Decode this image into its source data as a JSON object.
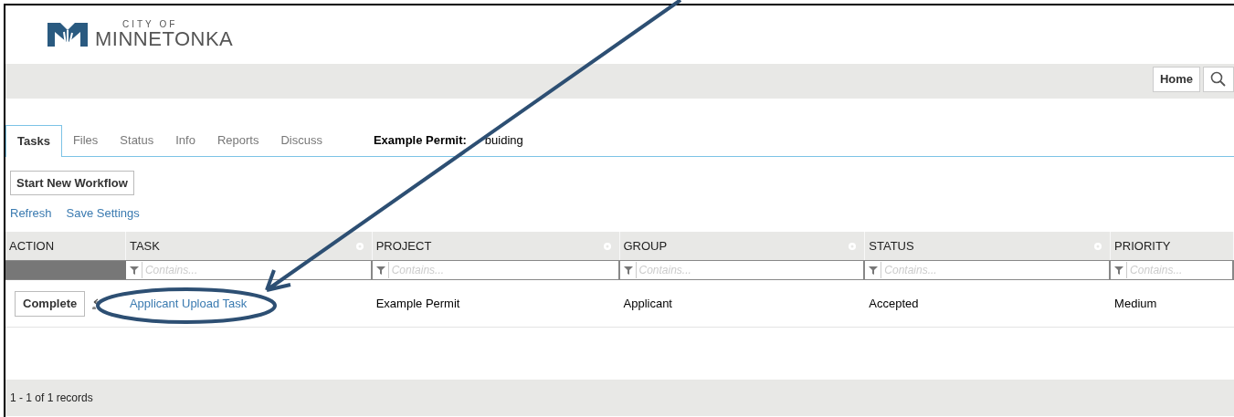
{
  "logo": {
    "small": "CITY OF",
    "big": "MINNETONKA"
  },
  "toolbar": {
    "home": "Home"
  },
  "tabs": [
    {
      "label": "Tasks",
      "selected": true
    },
    {
      "label": "Files",
      "selected": false
    },
    {
      "label": "Status",
      "selected": false
    },
    {
      "label": "Info",
      "selected": false
    },
    {
      "label": "Reports",
      "selected": false
    },
    {
      "label": "Discuss",
      "selected": false
    }
  ],
  "record": {
    "label": "Example Permit:",
    "value": "buiding"
  },
  "start_button": "Start New Workflow",
  "links": [
    "Refresh",
    "Save Settings"
  ],
  "table": {
    "columns": [
      {
        "label": "ACTION",
        "settings": false
      },
      {
        "label": "TASK",
        "settings": true,
        "filter_placeholder": "Contains..."
      },
      {
        "label": "PROJECT",
        "settings": true,
        "filter_placeholder": "Contains..."
      },
      {
        "label": "GROUP",
        "settings": true,
        "filter_placeholder": "Contains..."
      },
      {
        "label": "STATUS",
        "settings": true,
        "filter_placeholder": "Contains..."
      },
      {
        "label": "PRIORITY",
        "settings": false,
        "filter_placeholder": "Contains..."
      }
    ],
    "rows": [
      {
        "action": "Complete",
        "task": "Applicant Upload Task",
        "project": "Example Permit",
        "group": "Applicant",
        "status": "Accepted",
        "priority": "Medium"
      }
    ]
  },
  "footer": "1 - 1 of 1 records"
}
